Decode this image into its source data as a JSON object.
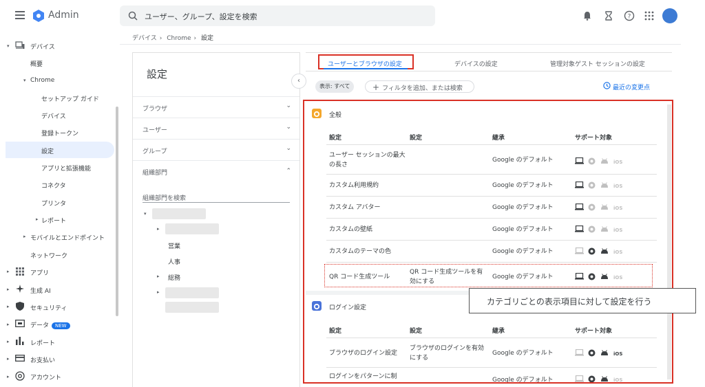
{
  "header": {
    "brand": "Admin",
    "search_placeholder": "ユーザー、グループ、設定を検索"
  },
  "breadcrumb": [
    "デバイス",
    "Chrome",
    "設定"
  ],
  "sidebar": {
    "devices": "デバイス",
    "overview": "概要",
    "chrome": "Chrome",
    "setup_guide": "セットアップ ガイド",
    "devices_sub": "デバイス",
    "enroll_tokens": "登録トークン",
    "settings": "設定",
    "apps": "アプリと拡張機能",
    "connectors": "コネクタ",
    "printers": "プリンタ",
    "reports_sub": "レポート",
    "mobile": "モバイルとエンドポイント",
    "network": "ネットワーク",
    "apps_main": "アプリ",
    "gen_ai": "生成 AI",
    "security": "セキュリティ",
    "data": "データ",
    "new_badge": "NEW",
    "reports": "レポート",
    "billing": "お支払い",
    "account": "アカウント"
  },
  "left_panel": {
    "title": "設定",
    "rows": [
      "ブラウザ",
      "ユーザー",
      "グループ",
      "組織部門"
    ],
    "org_search_placeholder": "組織部門を検索",
    "tree": [
      "営業",
      "人事",
      "総務"
    ]
  },
  "tabs": [
    "ユーザーとブラウザの設定",
    "デバイスの設定",
    "管理対象ゲスト セッションの設定"
  ],
  "filter": {
    "chip": "表示: すべて",
    "add": "フィルタを追加、または検索",
    "recent": "最近の変更点"
  },
  "columns": [
    "設定",
    "設定",
    "継承",
    "サポート対象"
  ],
  "sections": [
    {
      "title": "全般",
      "rows": [
        {
          "name": "ユーザー セッションの最大の長さ",
          "setting": "",
          "inherit": "Google のデフォルト"
        },
        {
          "name": "カスタム利用規約",
          "setting": "",
          "inherit": "Google のデフォルト"
        },
        {
          "name": "カスタム アバター",
          "setting": "",
          "inherit": "Google のデフォルト"
        },
        {
          "name": "カスタムの壁紙",
          "setting": "",
          "inherit": "Google のデフォルト"
        },
        {
          "name": "カスタムのテーマの色",
          "setting": "",
          "inherit": "Google のデフォルト"
        },
        {
          "name": "QR コード生成ツール",
          "setting": "QR コード生成ツールを有効にする",
          "inherit": "Google のデフォルト"
        }
      ]
    },
    {
      "title": "ログイン設定",
      "rows": [
        {
          "name": "ブラウザのログイン設定",
          "setting": "ブラウザのログインを有効にする",
          "inherit": "Google のデフォルト"
        },
        {
          "name": "ログインをパターンに制",
          "setting": "",
          "inherit": "Google のデフォルト"
        }
      ]
    }
  ],
  "callout": "カテゴリごとの表示項目に対して設定を行う",
  "colors": {
    "accent": "#1a73e8",
    "highlight": "#d93025"
  },
  "icons": [
    "menu-icon",
    "search-icon",
    "bell-icon",
    "hourglass-icon",
    "help-icon",
    "apps-grid-icon",
    "laptop-icon",
    "chrome-icon",
    "android-icon",
    "ios-icon",
    "gear-icon",
    "history-icon"
  ]
}
